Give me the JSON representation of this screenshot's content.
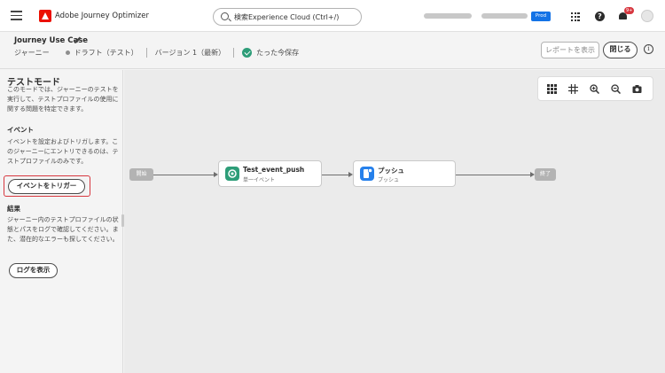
{
  "app": {
    "name": "Adobe Journey Optimizer",
    "search_placeholder": "検索Experience Cloud (Ctrl+/)",
    "org_label": "Prod",
    "notification_count": "9+"
  },
  "journey": {
    "title": "Journey Use Case",
    "type": "ジャーニー",
    "status": "ドラフト（テスト）",
    "version": "バージョン 1（最新）",
    "save_state": "たった今保存"
  },
  "header_actions": {
    "report_label": "レポートを表示",
    "close_label": "閉じる"
  },
  "test_panel": {
    "title": "テストモード",
    "description": "このモードでは、ジャーニーのテストを実行して、テストプロファイルの使用に関する問題を特定できます。",
    "event_heading": "イベント",
    "event_description": "イベントを設定およびトリガします。このジャーニーにエントリできるのは、テストプロファイルのみです。",
    "trigger_button": "イベントをトリガー",
    "results_heading": "結果",
    "results_description": "ジャーニー内のテストプロファイルの状態とパスをログで確認してください。また、潜在的なエラーも探してください。",
    "log_button": "ログを表示"
  },
  "canvas": {
    "start_label": "開始",
    "end_label": "終了",
    "nodes": [
      {
        "title": "Test_event_push",
        "subtitle": "単一イベント",
        "icon": "event-icon",
        "color": "#2d9d78"
      },
      {
        "title": "プッシュ",
        "subtitle": "プッシュ",
        "icon": "push-icon",
        "color": "#2680eb"
      }
    ],
    "tools": [
      "grid-icon",
      "arrange-icon",
      "zoom-in-icon",
      "zoom-out-icon",
      "screenshot-icon"
    ]
  },
  "colors": {
    "accent": "#1473e6",
    "brand": "#eb1000",
    "highlight": "#d7373f",
    "success": "#2d9d78"
  }
}
